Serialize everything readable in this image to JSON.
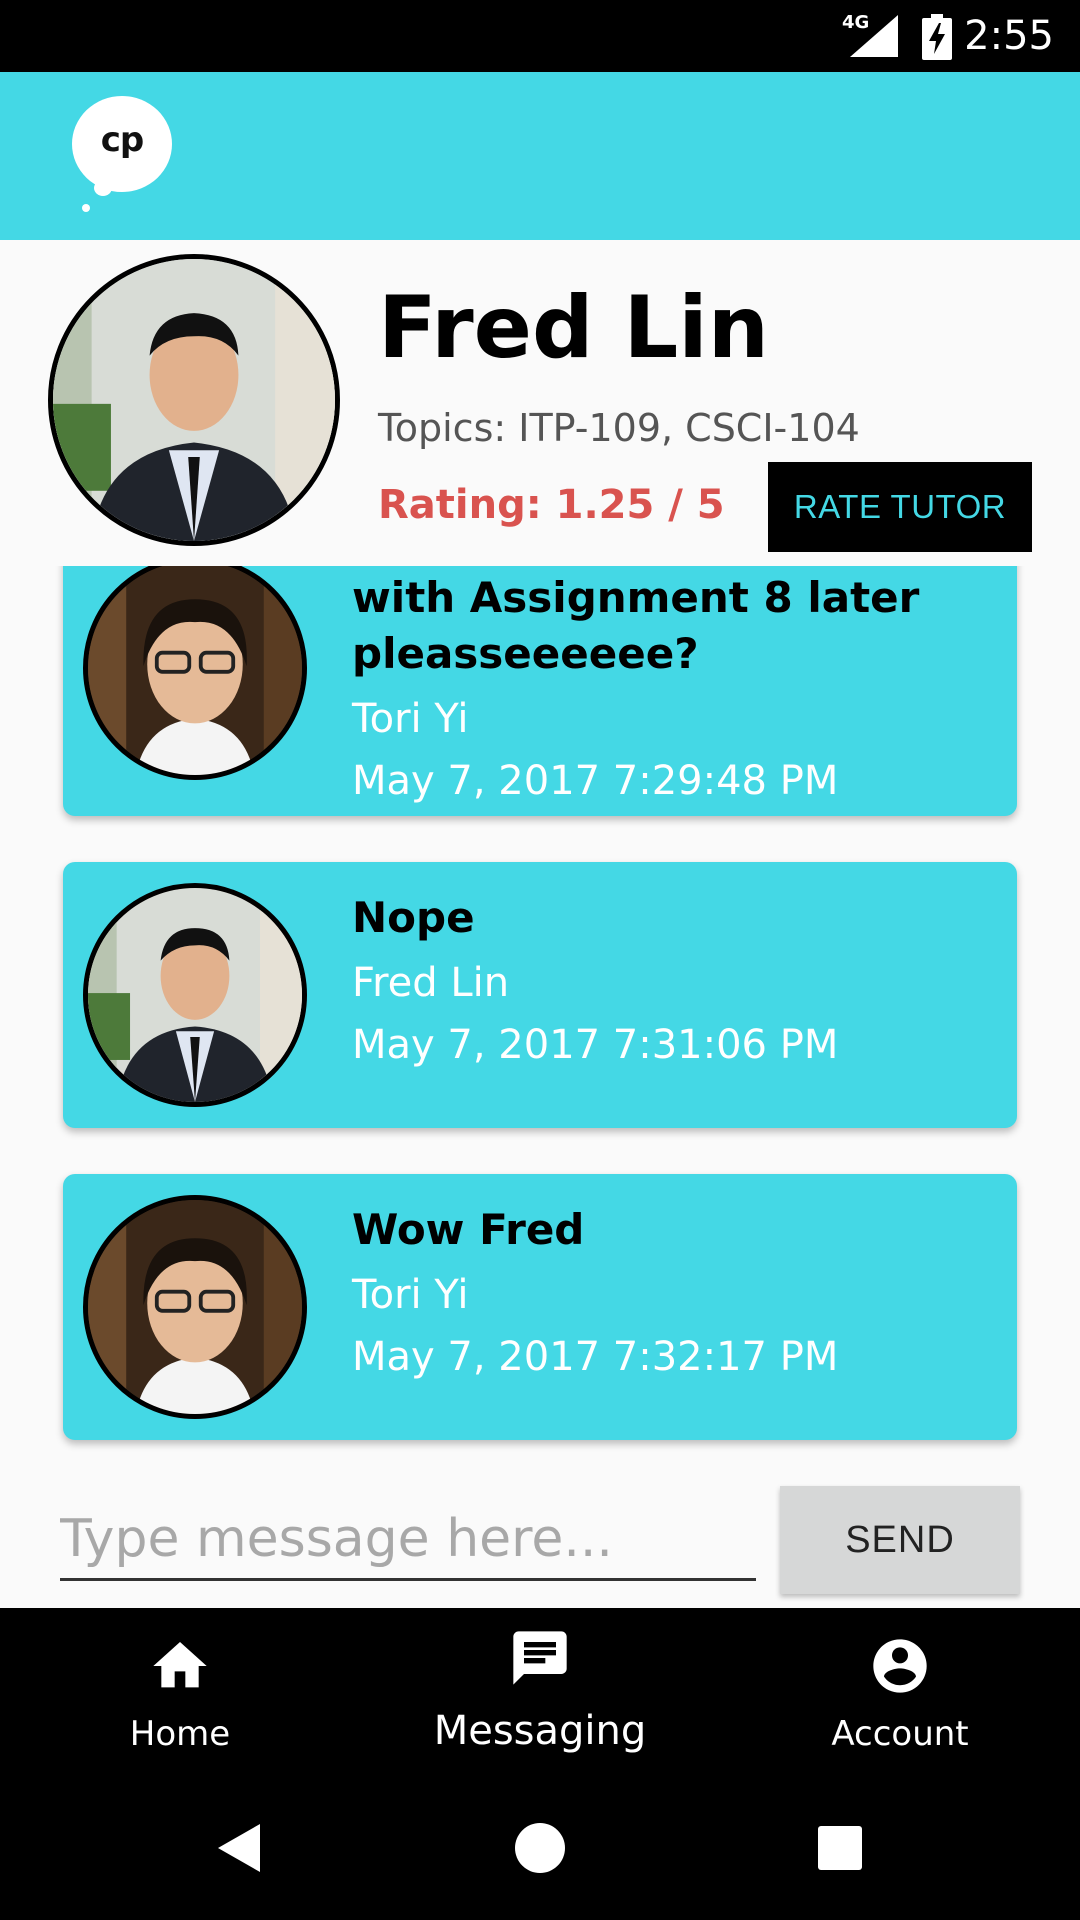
{
  "status_bar": {
    "network": "4G",
    "time": "2:55"
  },
  "app": {
    "logo_text": "cp",
    "accent": "#44d8e5"
  },
  "profile": {
    "name": "Fred Lin",
    "topics": "Topics: ITP-109, CSCI-104",
    "rating": "Rating: 1.25 / 5",
    "rate_button": "RATE TUTOR"
  },
  "messages": [
    {
      "text_line1": "with Assignment 8 later",
      "text_line2": "pleasseeeeee?",
      "sender": "Tori Yi",
      "time": "May 7, 2017 7:29:48 PM"
    },
    {
      "text": "Nope",
      "sender": "Fred Lin",
      "time": "May 7, 2017 7:31:06 PM"
    },
    {
      "text": "Wow Fred",
      "sender": "Tori Yi",
      "time": "May 7, 2017 7:32:17 PM"
    }
  ],
  "composer": {
    "placeholder": "Type message here...",
    "send_label": "SEND"
  },
  "bottom_nav": [
    {
      "label": "Home",
      "icon": "home-icon"
    },
    {
      "label": "Messaging",
      "icon": "message-icon"
    },
    {
      "label": "Account",
      "icon": "account-icon"
    }
  ],
  "system_nav": [
    "back-icon",
    "home-circle-icon",
    "recents-icon"
  ]
}
